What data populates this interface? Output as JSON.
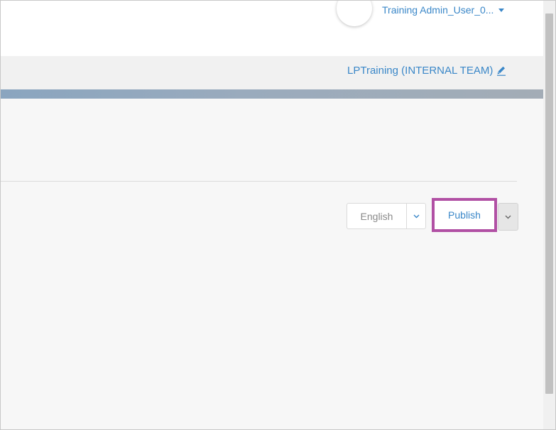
{
  "header": {
    "user_name": "Training Admin_User_0...",
    "user_menu_icon": "caret-down-icon"
  },
  "subheader": {
    "account_name": "LPTraining (INTERNAL TEAM)",
    "edit_icon": "pencil-icon"
  },
  "toolbar": {
    "language_value": "English",
    "language_icon": "chevron-down-icon",
    "publish_label": "Publish",
    "publish_menu_icon": "chevron-down-icon"
  },
  "colors": {
    "link": "#3a87c8",
    "highlight": "#b150a4",
    "accent_strip": "#8aa5bf"
  }
}
